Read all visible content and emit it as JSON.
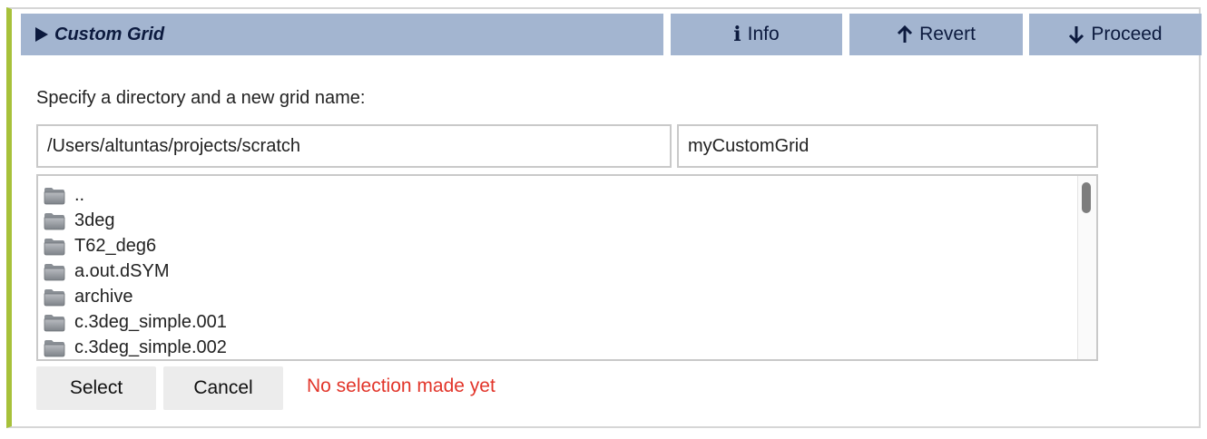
{
  "header": {
    "title": "Custom Grid",
    "buttons": {
      "info": "Info",
      "revert": "Revert",
      "proceed": "Proceed"
    }
  },
  "form": {
    "prompt": "Specify a directory and a new grid name:",
    "directory_value": "/Users/altuntas/projects/scratch",
    "grid_name_value": "myCustomGrid"
  },
  "file_list": {
    "items": [
      "..",
      "3deg",
      "T62_deg6",
      "a.out.dSYM",
      "archive",
      "c.3deg_simple.001",
      "c.3deg_simple.002"
    ]
  },
  "actions": {
    "select": "Select",
    "cancel": "Cancel"
  },
  "status": {
    "message": "No selection made yet"
  },
  "colors": {
    "accent_border": "#a7c13a",
    "header_bg": "#a3b5d0",
    "header_text": "#0c1a3e",
    "status_text": "#e2352a"
  },
  "icons": {
    "header": "caret-right-icon",
    "info": "info-icon",
    "revert": "arrow-up-icon",
    "proceed": "arrow-down-icon",
    "file_item": "folder-icon"
  }
}
